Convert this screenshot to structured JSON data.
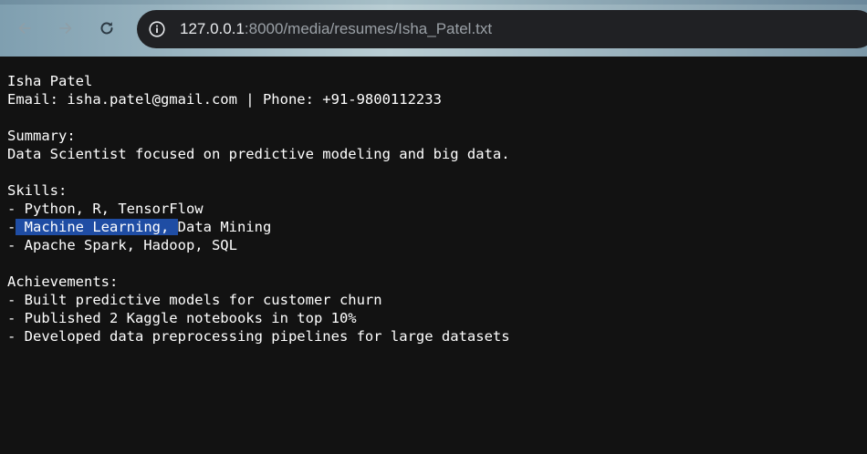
{
  "browser": {
    "url_host": "127.0.0.1",
    "url_rest": ":8000/media/resumes/Isha_Patel.txt",
    "icons": {
      "back": "arrow-left-icon",
      "forward": "arrow-right-icon",
      "reload": "reload-icon",
      "site_info": "info-icon"
    }
  },
  "document": {
    "name_line": "Isha Patel",
    "contact_line": "Email: isha.patel@gmail.com | Phone: +91-9800112233",
    "summary_heading": "Summary:",
    "summary_text": "Data Scientist focused on predictive modeling and big data.",
    "skills_heading": "Skills:",
    "skill_1": "- Python, R, TensorFlow",
    "skill_2_prefix": "-",
    "skill_2_selected": " Machine Learning, ",
    "skill_2_rest": "Data Mining",
    "skill_3": "- Apache Spark, Hadoop, SQL",
    "achievements_heading": "Achievements:",
    "achievement_1": "- Built predictive models for customer churn",
    "achievement_2": "- Published 2 Kaggle notebooks in top 10%",
    "achievement_3": "- Developed data preprocessing pipelines for large datasets"
  },
  "colors": {
    "page_background": "#121212",
    "text": "#ffffff",
    "selection": "#1f4da4",
    "omnibox": "#202124"
  }
}
